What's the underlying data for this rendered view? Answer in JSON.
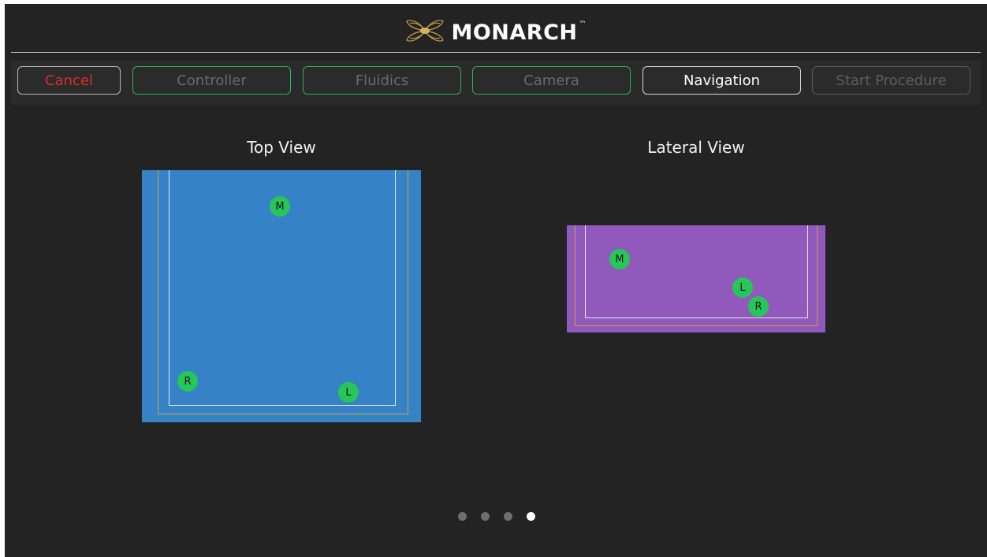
{
  "header": {
    "brand_name": "MONARCH",
    "brand_tm": "™",
    "logo_icon": "butterfly-logo-icon"
  },
  "steps": {
    "cancel": "Cancel",
    "controller": "Controller",
    "fluidics": "Fluidics",
    "camera": "Camera",
    "navigation": "Navigation",
    "start_procedure": "Start Procedure"
  },
  "top_view": {
    "title": "Top View",
    "markers": {
      "m": "M",
      "r": "R",
      "l": "L"
    }
  },
  "lateral_view": {
    "title": "Lateral View",
    "markers": {
      "m": "M",
      "l": "L",
      "r": "R"
    }
  },
  "pager": {
    "count": 4,
    "active_index": 3
  },
  "colors": {
    "background": "#232323",
    "top_view_panel": "#3583c6",
    "lateral_view_panel": "#9059bb",
    "marker": "#26c65a",
    "completed_step_border": "#2cb35a",
    "cancel_text": "#e02b2b",
    "frame_outer": "#c9a34a",
    "frame_inner": "#e8e8e8"
  }
}
